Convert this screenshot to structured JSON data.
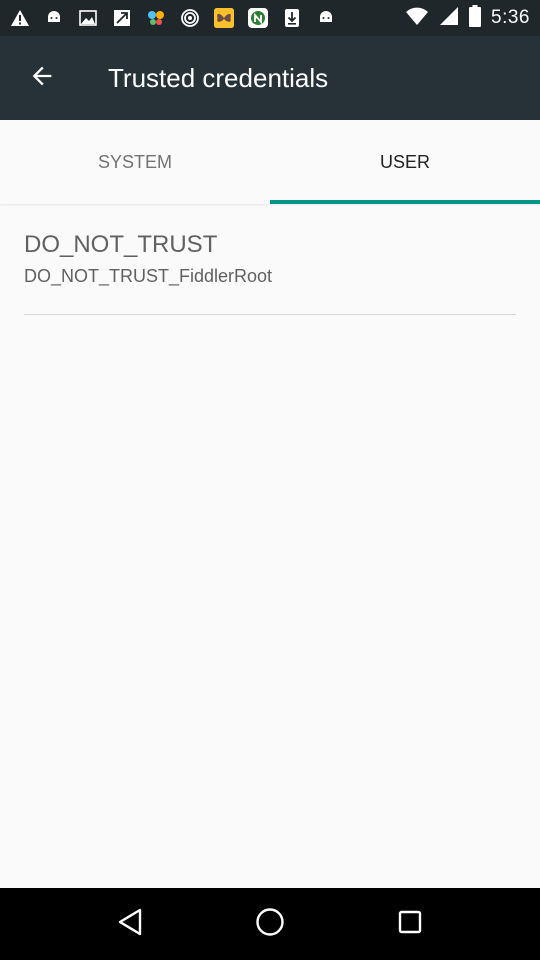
{
  "status_bar": {
    "time": "5:36",
    "icons": [
      "warning-icon",
      "android-icon",
      "image-icon",
      "send-icon",
      "butterfly-icon",
      "hotspot-icon",
      "butterfly-app-icon",
      "n-app-icon",
      "download-icon",
      "android-icon",
      "wifi-icon",
      "signal-icon",
      "battery-icon"
    ]
  },
  "app_bar": {
    "title": "Trusted credentials",
    "back_icon": "arrow-back-icon",
    "background": "#263238"
  },
  "tabs": [
    {
      "label": "SYSTEM",
      "selected": false
    },
    {
      "label": "USER",
      "selected": true
    }
  ],
  "accent_color": "#009688",
  "credentials": [
    {
      "title": "DO_NOT_TRUST",
      "subtitle": "DO_NOT_TRUST_FiddlerRoot"
    }
  ],
  "nav_bar": {
    "buttons": [
      "back-triangle-icon",
      "home-circle-icon",
      "recents-square-icon"
    ]
  }
}
